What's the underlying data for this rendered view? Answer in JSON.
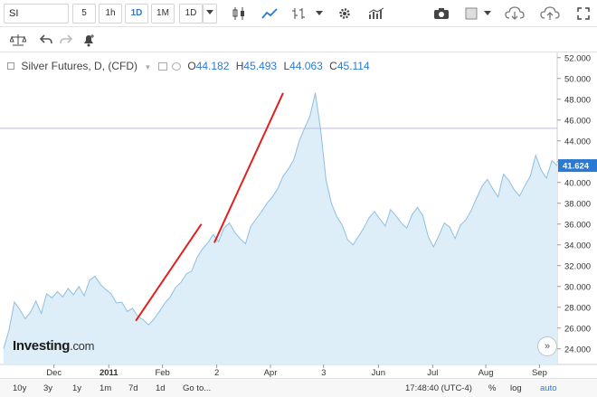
{
  "toolbar": {
    "symbol": "SI",
    "intervals": [
      "5",
      "1h",
      "1D",
      "1M"
    ],
    "active_interval": "1D",
    "chart_interval": "1D"
  },
  "legend": {
    "title": "Silver Futures, D, (CFD)",
    "open_label": "O",
    "open": "44.182",
    "high_label": "H",
    "high": "45.493",
    "low_label": "L",
    "low": "44.063",
    "close_label": "C",
    "close": "45.114"
  },
  "logo": {
    "main": "Investing",
    "suffix": ".com"
  },
  "bottom": {
    "ranges": [
      "10y",
      "3y",
      "1y",
      "1m",
      "7d",
      "1d",
      "Go to..."
    ],
    "time": "17:48:40 (UTC-4)",
    "options": [
      "%",
      "log",
      "auto"
    ]
  },
  "colors": {
    "accent": "#2a7ad5",
    "area_fill": "#ddeef8",
    "area_line": "#8fbfe0",
    "trend_line": "#e02020",
    "price_tag": "#2a7ad5"
  },
  "chart_data": {
    "type": "area",
    "title": "Silver Futures, D, (CFD)",
    "xlabel": "",
    "ylabel": "",
    "x_tick_labels": [
      "Dec",
      "2011",
      "Feb",
      "2",
      "Apr",
      "3",
      "Jun",
      "Jul",
      "Aug",
      "Sep"
    ],
    "y_tick_labels": [
      "24.000",
      "26.000",
      "28.000",
      "30.000",
      "32.000",
      "34.000",
      "36.000",
      "38.000",
      "40.000",
      "42.000",
      "44.000",
      "46.000",
      "48.000",
      "50.000",
      "52.000"
    ],
    "ylim": [
      22.5,
      52.5
    ],
    "current_price": "41.624",
    "horizontal_line": 45.2,
    "series": [
      {
        "values": [
          24.0,
          25.8,
          28.5,
          27.8,
          26.9,
          27.5,
          28.6,
          27.4,
          29.3,
          28.9,
          29.5,
          29.0,
          29.8,
          29.2,
          30.0,
          29.1,
          30.6,
          31.0,
          30.2,
          29.7,
          29.3,
          28.4,
          28.5,
          27.6,
          27.9,
          27.1,
          26.8,
          26.3,
          26.9,
          27.6,
          28.4,
          29.0,
          29.9,
          30.4,
          31.2,
          31.5,
          32.8,
          33.6,
          34.2,
          35.0,
          34.3,
          35.6,
          36.1,
          35.2,
          34.6,
          34.1,
          35.8,
          36.5,
          37.2,
          38.0,
          38.6,
          39.4,
          40.6,
          41.3,
          42.2,
          44.0,
          45.2,
          46.4,
          48.6,
          45.0,
          40.2,
          38.0,
          36.7,
          35.9,
          34.5,
          34.0,
          34.8,
          35.6,
          36.6,
          37.2,
          36.5,
          35.8,
          37.4,
          36.8,
          36.1,
          35.6,
          36.9,
          37.6,
          36.8,
          34.8,
          33.8,
          34.9,
          36.1,
          35.7,
          34.6,
          35.9,
          36.4,
          37.3,
          38.5,
          39.6,
          40.3,
          39.4,
          38.6,
          40.8,
          40.2,
          39.3,
          38.7,
          39.7,
          40.6,
          42.6,
          41.2,
          40.4,
          42.1,
          41.6
        ]
      }
    ],
    "trend_segments": [
      {
        "x0": 24.6,
        "y0": 26.7,
        "x1": 36.8,
        "y1": 36.0
      },
      {
        "x0": 39.2,
        "y0": 34.2,
        "x1": 52.0,
        "y1": 48.6
      }
    ]
  }
}
